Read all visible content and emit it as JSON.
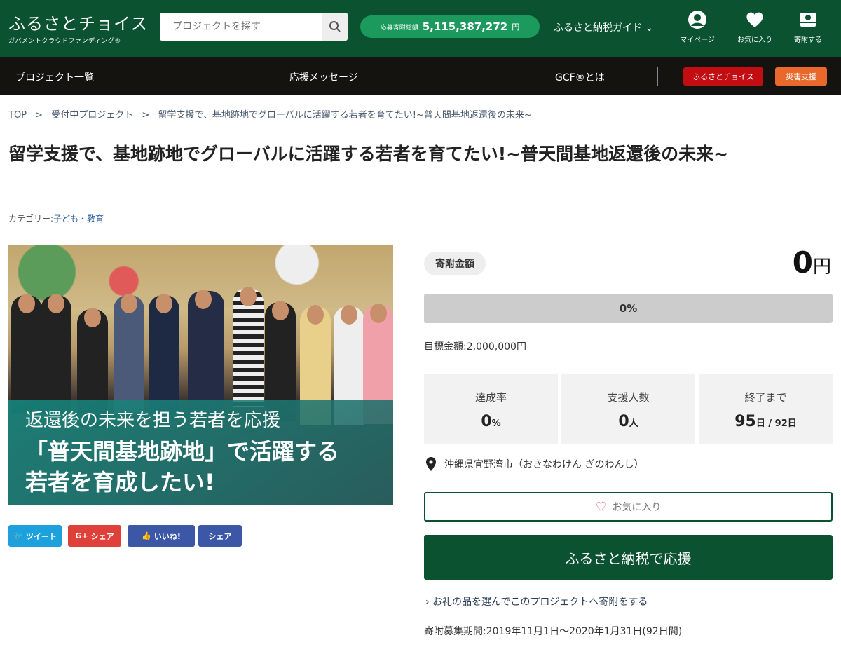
{
  "header": {
    "logo_title": "ふるさとチョイス",
    "logo_sub": "ガバメントクラウドファンディング®",
    "search_placeholder": "プロジェクトを探す",
    "total_label": "応募寄附総額",
    "total_value": "5,115,387,272",
    "total_unit": "円",
    "guide": "ふるさと納税ガイド",
    "icons": [
      {
        "icon": "user-icon",
        "label": "マイページ"
      },
      {
        "icon": "heart-icon",
        "label": "お気に入り"
      },
      {
        "icon": "donate-icon",
        "label": "寄附する"
      }
    ]
  },
  "nav": {
    "items": [
      "プロジェクト一覧",
      "応援メッセージ",
      "GCF®とは"
    ],
    "tag_choice": "ふるさとチョイス",
    "tag_disaster": "災害支援",
    "colors": {
      "choice": "#c20e12",
      "disaster": "#e8692b"
    }
  },
  "breadcrumb": [
    "TOP",
    ">",
    "受付中プロジェクト",
    ">",
    "留学支援で、基地跡地でグローバルに活躍する若者を育てたい!~普天間基地返還後の未来~"
  ],
  "title": "留学支援で、基地跡地でグローバルに活躍する若者を育てたい!~普天間基地返還後の未来~",
  "category_label": "カテゴリー:",
  "category": "子ども・教育",
  "image_overlay": [
    "返還後の未来を担う若者を応援",
    "「普天間基地跡地」で活躍する",
    "若者を育成したい!"
  ],
  "share": {
    "tweet": "ツイート",
    "gplus": "シェア",
    "like": "いいね!",
    "fb_share": "シェア"
  },
  "donation": {
    "label": "寄附金額",
    "amount": "0",
    "unit": "円",
    "progress_percent": 0,
    "progress_text": "0%",
    "goal": "目標金額:2,000,000円"
  },
  "stats": [
    {
      "label": "達成率",
      "value": "0",
      "unit": "%"
    },
    {
      "label": "支援人数",
      "value": "0",
      "unit": "人"
    },
    {
      "label": "終了まで",
      "value": "95",
      "unit": "日 / 92日"
    }
  ],
  "location": "沖縄県宜野湾市（おきなわけん ぎのわんし）",
  "favorite": "お気に入り",
  "cta": "ふるさと納税で応援",
  "gift_link": "お礼の品を選んでこのプロジェクトへ寄附をする",
  "period": "寄附募集期間:2019年11月1日～2020年1月31日(92日間)"
}
